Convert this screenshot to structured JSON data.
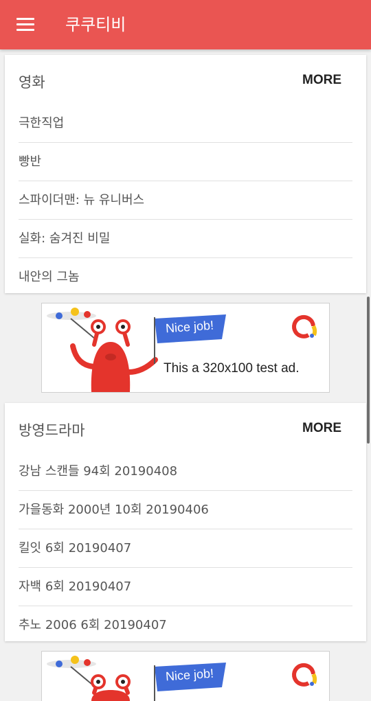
{
  "app": {
    "title": "쿠쿠티비"
  },
  "sections": [
    {
      "title": "영화",
      "more_label": "MORE",
      "items": [
        "극한직업",
        "빵반",
        "스파이더맨: 뉴 유니버스",
        "실화: 숨겨진 비밀",
        "내안의 그놈"
      ]
    },
    {
      "title": "방영드라마",
      "more_label": "MORE",
      "items": [
        "강남 스캔들 94회 20190408",
        "가을동화 2000년 10회 20190406",
        "킬잇 6회 20190407",
        "자백 6회 20190407",
        "추노 2006 6회 20190407"
      ]
    }
  ],
  "ads": [
    {
      "badge": "Nice job!",
      "text": "This a 320x100 test ad."
    },
    {
      "badge": "Nice job!"
    }
  ],
  "colors": {
    "appbar": "#ea5552",
    "monster": "#e4342c",
    "ribbon": "#3f6bd8"
  }
}
